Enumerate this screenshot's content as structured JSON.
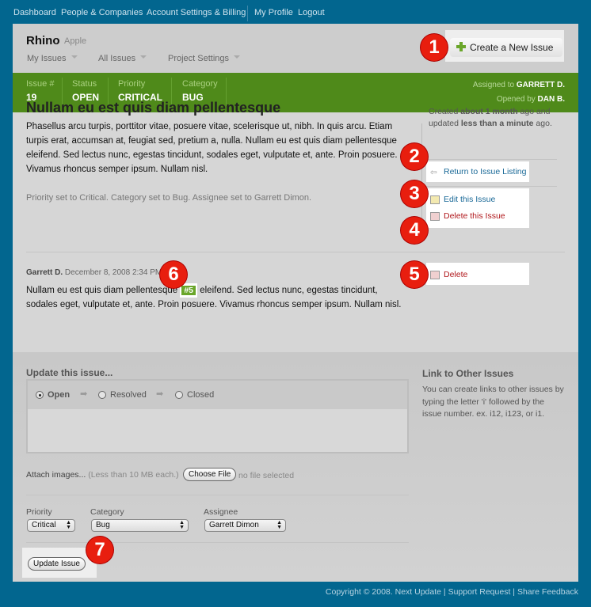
{
  "topnav": {
    "items": [
      "Dashboard",
      "People & Companies",
      "Account Settings & Billing",
      "My Profile",
      "Logout"
    ]
  },
  "header": {
    "project": "Rhino",
    "company": "Apple",
    "menus": [
      "My Issues",
      "All Issues",
      "Project Settings"
    ],
    "create_button": "Create a New Issue"
  },
  "issue_bar": {
    "number_label": "Issue #",
    "number": "19",
    "status_label": "Status",
    "status": "OPEN",
    "priority_label": "Priority",
    "priority": "CRITICAL",
    "category_label": "Category",
    "category": "BUG",
    "assigned_prefix": "Assigned to",
    "assigned": "GARRETT D.",
    "opened_prefix": "Opened by",
    "opened": "DAN B."
  },
  "issue": {
    "title": "Nullam eu est quis diam pellentesque",
    "body": "Phasellus arcu turpis, porttitor vitae, posuere vitae, scelerisque ut, nibh. In quis arcu. Etiam turpis erat, accumsan at, feugiat sed, pretium a, nulla. Nullam eu est quis diam pellentesque eleifend. Sed lectus nunc, egestas tincidunt, sodales eget, vulputate et, ante. Proin posuere. Vivamus rhoncus semper ipsum. Nullam nisl.",
    "changes": "Priority set to Critical. Category set to Bug. Assignee set to Garrett Dimon."
  },
  "sidebar": {
    "created_prefix": "Created",
    "created": "about 1 month",
    "created_mid": "ago and updated",
    "updated": "less than a minute",
    "updated_suffix": "ago.",
    "return": "Return to Issue Listing",
    "edit": "Edit this Issue",
    "delete": "Delete this Issue"
  },
  "comment": {
    "author": "Garrett D.",
    "date": "December 8, 2008 2:34 PM",
    "text_before": "Nullam eu est quis diam pellentesque",
    "tag": "#5",
    "text_after": "eleifend. Sed lectus nunc, egestas tincidunt, sodales eget, vulputate et, ante. Proin posuere. Vivamus rhoncus semper ipsum. Nullam nisl.",
    "delete": "Delete"
  },
  "update": {
    "title": "Update this issue...",
    "states": [
      "Open",
      "Resolved",
      "Closed"
    ],
    "selected_state": "Open",
    "attach_label": "Attach images...",
    "attach_hint": "(Less than 10 MB each.)",
    "choose_file": "Choose File",
    "no_file": "no file selected",
    "priority_label": "Priority",
    "priority": "Critical",
    "category_label": "Category",
    "category": "Bug",
    "assignee_label": "Assignee",
    "assignee": "Garrett Dimon",
    "submit": "Update Issue"
  },
  "link_help": {
    "title": "Link to Other Issues",
    "text": "You can create links to other issues by typing the letter 'i' followed by the issue number. ex. i12, i123, or i1."
  },
  "footer": {
    "copyright": "Copyright © 2008.",
    "links": [
      "Next Update",
      "Support Request",
      "Share Feedback"
    ]
  },
  "callouts": [
    "1",
    "2",
    "3",
    "4",
    "5",
    "6",
    "7"
  ],
  "colors": {
    "background": "#02668f",
    "accent_green": "#4f8a1a",
    "callout": "#e81e0f",
    "link": "#1b6a98",
    "danger": "#b0161a"
  }
}
